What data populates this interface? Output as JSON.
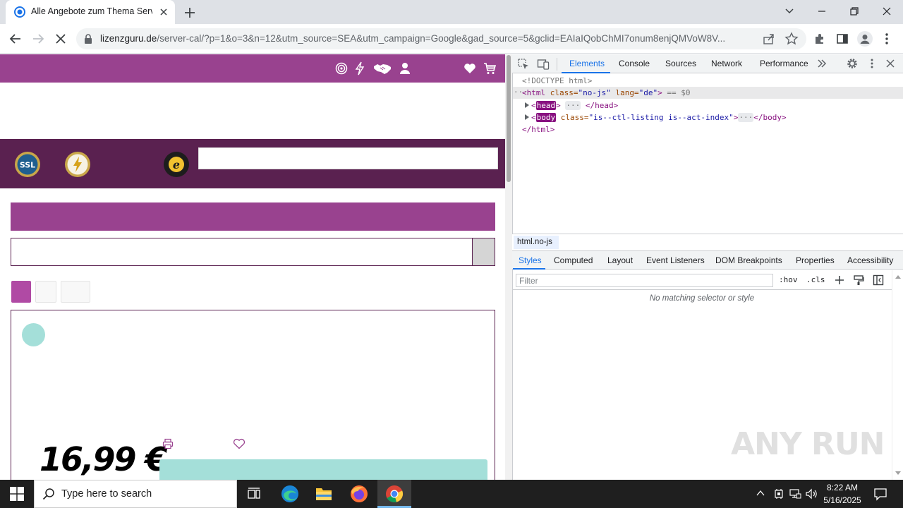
{
  "browser": {
    "tab_title": "Alle Angebote zum Thema Server",
    "url_host": "lizenzguru.de",
    "url_rest": "/server-cal/?p=1&o=3&n=12&utm_source=SEA&utm_campaign=Google&gad_source=5&gclid=EAIaIQobChMI7onum8enjQMVoW8V..."
  },
  "site": {
    "price": "16,99 €",
    "badges": [
      "ssl-badge",
      "express-badge",
      "trusted-shops-badge"
    ],
    "accent_color": "#99428f",
    "dark_color": "#5a2150",
    "teal_color": "#a4dfd9"
  },
  "devtools": {
    "tabs": [
      "Elements",
      "Console",
      "Sources",
      "Network",
      "Performance"
    ],
    "doctype": "<!DOCTYPE html>",
    "html_open_tag": "<html",
    "html_class_attr": " class=",
    "html_class_val": "\"no-js\"",
    "html_lang_attr": " lang=",
    "html_lang_val": "\"de\"",
    "html_close_bracket": ">",
    "selected_marker": " == $0",
    "head_name": "head",
    "head_close": "</head>",
    "body_name": "body",
    "body_class_attr": " class=",
    "body_class_val": "\"is--ctl-listing is--act-index\"",
    "body_close": "</body>",
    "html_close": "</html>",
    "breadcrumb": "html.no-js",
    "subtabs": [
      "Styles",
      "Computed",
      "Layout",
      "Event Listeners",
      "DOM Breakpoints",
      "Properties",
      "Accessibility"
    ],
    "filter_placeholder": "Filter",
    "hov_label": ":hov",
    "cls_label": ".cls",
    "no_match": "No matching selector or style"
  },
  "taskbar": {
    "search_placeholder": "Type here to search",
    "time": "8:22 AM",
    "date": "5/16/2025"
  },
  "watermark": "ANY RUN"
}
